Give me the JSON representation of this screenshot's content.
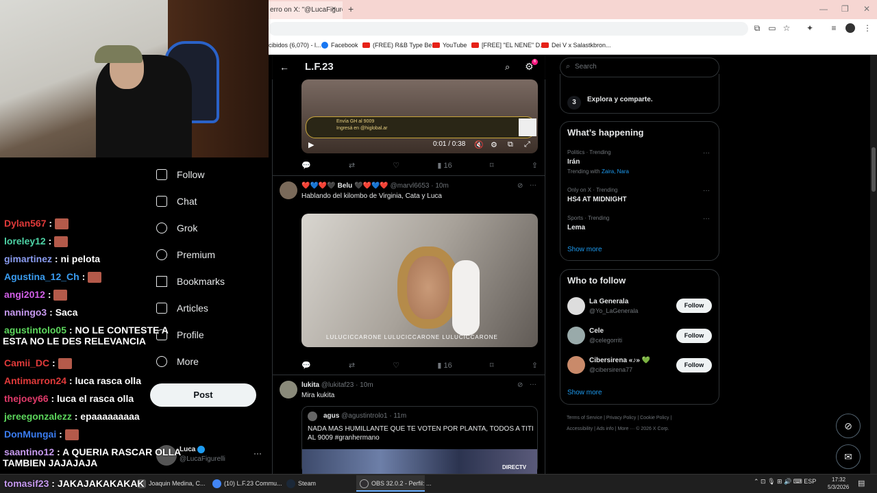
{
  "browser": {
    "tab_title": "erro on X: \"@LucaFigure",
    "tab_close": "×",
    "new_tab": "+",
    "window_controls": [
      "—",
      "❐",
      "✕"
    ],
    "bookmarks": [
      {
        "label": "cibidos (6,070) - l...",
        "icon": "mail"
      },
      {
        "label": "Facebook",
        "icon": "facebook"
      },
      {
        "label": "(FREE) R&B Type Be...",
        "icon": "youtube"
      },
      {
        "label": "YouTube",
        "icon": "youtube"
      },
      {
        "label": "[FREE] \"EL NENE\" D...",
        "icon": "youtube"
      },
      {
        "label": "Dei V x Salastkbron...",
        "icon": "youtube"
      }
    ]
  },
  "chat": [
    {
      "user": "Dylan567",
      "color": "#e03a3a",
      "msg": "",
      "emote": true
    },
    {
      "user": "loreley12",
      "color": "#4ed3a6",
      "msg": "",
      "emote": true
    },
    {
      "user": "gimartinez",
      "color": "#8a9cf0",
      "msg": "ni pelota",
      "emote": false
    },
    {
      "user": "Agustina_12_Ch",
      "color": "#3a9cf0",
      "msg": "",
      "emote": true
    },
    {
      "user": "angi2012",
      "color": "#d25fe8",
      "msg": "",
      "emote": true
    },
    {
      "user": "naningo3",
      "color": "#c79af0",
      "msg": "Saca",
      "emote": false
    },
    {
      "user": "agustintolo05",
      "color": "#5cd65c",
      "msg": "NO LE CONTESTE A",
      "msg2": "ESTA NO LE DES RELEVANCIA",
      "emote": false
    },
    {
      "user": "Camii_DC",
      "color": "#e03a3a",
      "msg": "",
      "emote": true
    },
    {
      "user": "Antimarron24",
      "color": "#e03a3a",
      "msg": "luca rasca olla",
      "emote": false
    },
    {
      "user": "thejoey66",
      "color": "#e03a6a",
      "msg": "luca el rasca olla",
      "emote": false
    },
    {
      "user": "jereegonzalezz",
      "color": "#5cd65c",
      "msg": "epaaaaaaaaa",
      "emote": false
    },
    {
      "user": "DonMungai",
      "color": "#3a7cf0",
      "msg": "",
      "emote": true
    },
    {
      "user": "saantino12",
      "color": "#c79af0",
      "msg": "A QUERIA RASCAR OLLA",
      "msg2": "TAMBIEN JAJAJAJA",
      "emote": false
    },
    {
      "user": "tomasif23",
      "color": "#c79af0",
      "msg": "JAKAJAKAKAKAK",
      "emote": false
    }
  ],
  "nav": {
    "items": [
      "Follow",
      "Chat",
      "Grok",
      "Premium",
      "Bookmarks",
      "Articles",
      "Profile",
      "More"
    ],
    "post_label": "Post",
    "account_name": "Luca",
    "account_handle": "@LucaFigurelli"
  },
  "feed": {
    "title": "L.F.23",
    "notif_count": "6",
    "video1": {
      "time": "0:01 / 0:38",
      "banner_line1": "Envía GH al 9009",
      "banner_line2": "Ingresá en @higlobal.ar"
    },
    "tweet1_stats": {
      "views": "16"
    },
    "tweet2": {
      "name": "Belu",
      "hearts_before": "❤️💙❤️🖤",
      "hearts_after": "🖤❤️💙❤️",
      "handle": "@marvl6653",
      "time": "· 10m",
      "text": "Hablando del kilombo de Virginia, Cata y Luca",
      "credits": "LULUCICCARONE   LULUCICCARONE   LULUCICCARONE",
      "views": "16"
    },
    "tweet3": {
      "name": "lukita",
      "handle": "@lukitaf23",
      "time": "· 10m",
      "text": "Mira kukita",
      "quote_name": "agus",
      "quote_handle": "@agustintrolo1",
      "quote_time": "· 11m",
      "quote_text": "NADA MAS HUMILLANTE QUE TE VOTEN POR PLANTA, TODOS A TITI AL 9009 #granhermano",
      "quote_badge": "DIRECTV"
    }
  },
  "right": {
    "search_placeholder": "Search",
    "step_num": "3",
    "step_text": "Explora y comparte.",
    "trending_title": "What’s happening",
    "trends": [
      {
        "meta": "Politics · Trending",
        "name": "Irán",
        "with_label": "Trending with",
        "with": "Zaira, Nara"
      },
      {
        "meta": "Only on X · Trending",
        "name": "HS4 AT MIDNIGHT"
      },
      {
        "meta": "Sports · Trending",
        "name": "Lema"
      }
    ],
    "show_more": "Show more",
    "wtf_title": "Who to follow",
    "follow_suggestions": [
      {
        "name": "La Generala",
        "handle": "@Yo_LaGenerala",
        "button": "Follow"
      },
      {
        "name": "Cele",
        "handle": "@celegorriti",
        "button": "Follow"
      },
      {
        "name": "Cibersirena «♪» 💚",
        "handle": "@cibersirena77",
        "button": "Follow"
      }
    ],
    "footer_line1": "Terms of Service  |  Privacy Policy  |  Cookie Policy  |",
    "footer_line2": "Accessibility  |  Ads info  |  More ···  © 2026 X Corp."
  },
  "taskbar": {
    "items": [
      "Joaquin Medina, C...",
      "(10) L.F.23 Commu...",
      "Steam",
      "OBS 32.0.2 - Perfil: ..."
    ],
    "language": "ESP",
    "time": "17:32",
    "date": "5/3/2026"
  },
  "colors": {
    "accent": "#1d9bf0",
    "bg": "#000000",
    "border": "#2f3336",
    "muted": "#71767b"
  }
}
